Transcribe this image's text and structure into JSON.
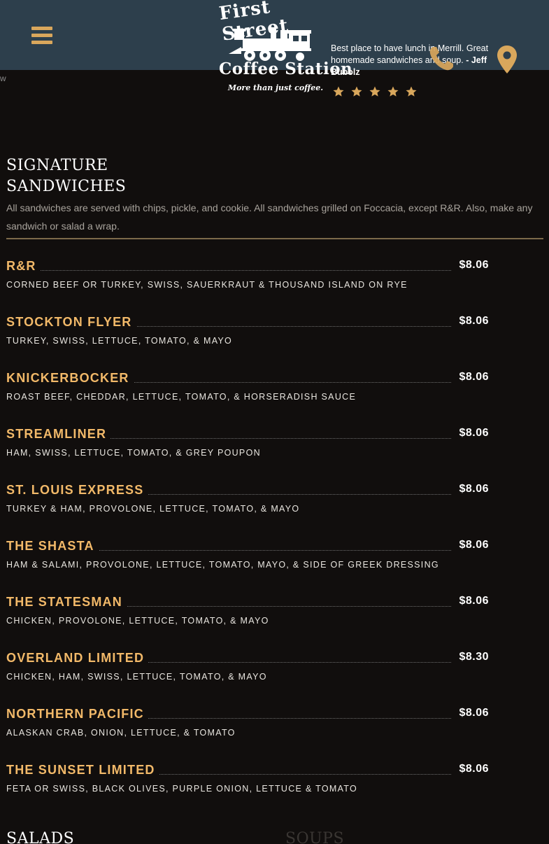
{
  "header": {
    "menu_icon": "hamburger-menu-icon",
    "stray_text": "w",
    "logo": {
      "top_text": "First Street",
      "bottom_text": "Coffee Station",
      "tagline": "More than just coffee."
    },
    "review": {
      "quote": "Best place to have lunch in Merrill. Great homemade sandwiches and soup.",
      "author": "- Jeff Bubolz",
      "stars": 5
    },
    "phone_icon": "phone-icon",
    "map_icon": "map-marker-icon"
  },
  "section": {
    "title_line1": "SIGNATURE",
    "title_line2": "SANDWICHES",
    "description": "All sandwiches are served with chips, pickle, and cookie. All sandwiches grilled on Foccacia, except R&R. Also, make any sandwich or salad a wrap."
  },
  "items": [
    {
      "name": "R&R",
      "price": "$8.06",
      "desc": "Corned Beef or Turkey, Swiss, Sauerkraut & Thousand Island on Rye"
    },
    {
      "name": "STOCKTON FLYER",
      "price": "$8.06",
      "desc": "Turkey, Swiss, Lettuce, Tomato, & Mayo"
    },
    {
      "name": "KNICKERBOCKER",
      "price": "$8.06",
      "desc": "Roast Beef, Cheddar, Lettuce, Tomato, & Horseradish Sauce"
    },
    {
      "name": "STREAMLINER",
      "price": "$8.06",
      "desc": "Ham, Swiss, Lettuce, Tomato, & Grey Poupon"
    },
    {
      "name": "ST. LOUIS EXPRESS",
      "price": "$8.06",
      "desc": "Turkey & Ham, Provolone, Lettuce, Tomato, & Mayo"
    },
    {
      "name": "THE SHASTA",
      "price": "$8.06",
      "desc": "Ham & Salami, Provolone, Lettuce, Tomato, Mayo, & side of Greek Dressing"
    },
    {
      "name": "THE STATESMAN",
      "price": "$8.06",
      "desc": "Chicken, Provolone, Lettuce, Tomato, & Mayo"
    },
    {
      "name": "OVERLAND LIMITED",
      "price": "$8.30",
      "desc": "Chicken, Ham, Swiss, Lettuce, Tomato, & Mayo"
    },
    {
      "name": "NORTHERN PACIFIC",
      "price": "$8.06",
      "desc": "Alaskan Crab, Onion, Lettuce, & Tomato"
    },
    {
      "name": "THE SUNSET LIMITED",
      "price": "$8.06",
      "desc": "Feta or Swiss, Black Olives, Purple Onion, Lettuce & Tomato"
    }
  ],
  "next_sections": {
    "left": "SALADS",
    "right": "SOUPS"
  },
  "colors": {
    "header_bg": "#2d3f4c",
    "page_bg": "#110e0d",
    "accent": "#f2b969",
    "icon": "#d9a75c"
  }
}
